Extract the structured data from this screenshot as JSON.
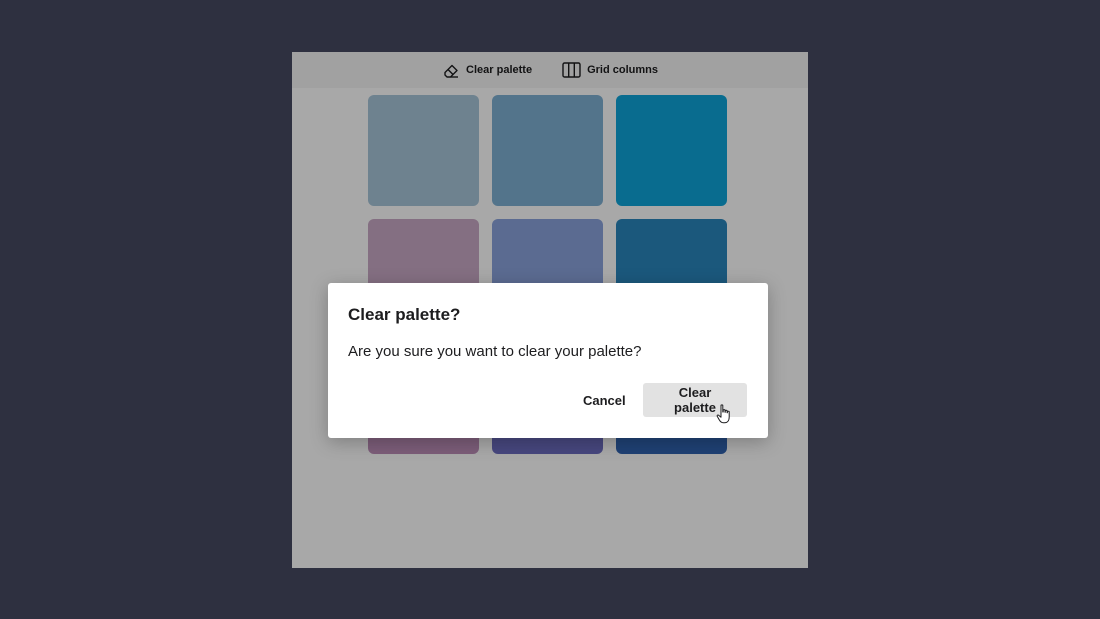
{
  "toolbar": {
    "clear_palette_label": "Clear palette",
    "clear_palette_icon": "eraser-icon",
    "grid_columns_label": "Grid columns",
    "grid_columns_icon": "columns-icon"
  },
  "palette": {
    "swatches": [
      {
        "color": "#a7c5d9"
      },
      {
        "color": "#7fb0d4"
      },
      {
        "color": "#0ea5d9"
      },
      {
        "color": "#c8a9c5"
      },
      {
        "color": "#8aa3dd"
      },
      {
        "color": "#2a86bd"
      },
      {
        "color": "#bd8db8"
      },
      {
        "color": "#6c6cc0"
      },
      {
        "color": "#2f63b0"
      }
    ]
  },
  "dialog": {
    "title": "Clear palette?",
    "message": "Are you sure you want to clear your palette?",
    "cancel_label": "Cancel",
    "confirm_label": "Clear palette"
  }
}
